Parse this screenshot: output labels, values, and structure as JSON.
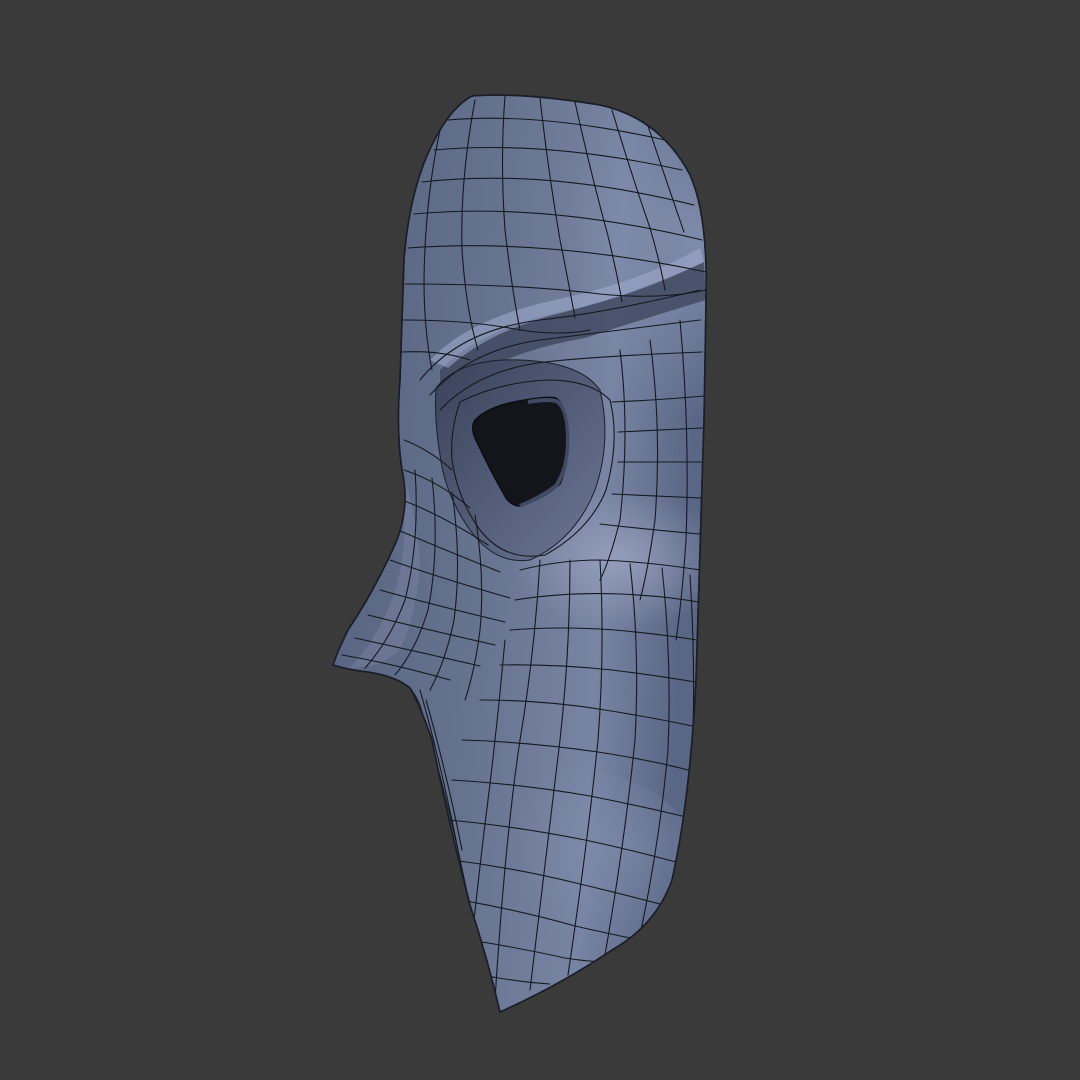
{
  "scene": {
    "background_color": "#3a3a3a",
    "model": {
      "subject": "mask",
      "view": "side",
      "shading": "solid",
      "wireframe_overlay": true,
      "base_color": "#5d6a89",
      "highlight_color": "#8b97b6",
      "shadow_color": "#343c53",
      "wire_color": "#15181f",
      "eye_hole_color": "#12151b"
    }
  }
}
